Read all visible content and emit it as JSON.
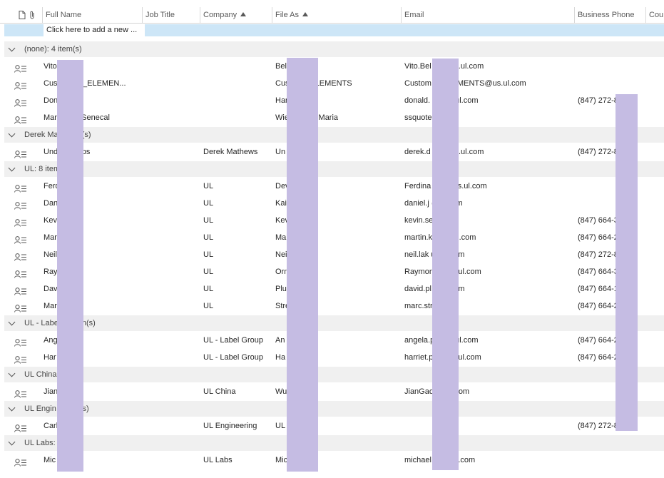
{
  "columns": {
    "full_name": "Full Name",
    "job_title": "Job Title",
    "company": "Company",
    "file_as": "File As",
    "email": "Email",
    "business_phone": "Business Phone",
    "country": "Cou"
  },
  "add_new": "Click here to add a new ...",
  "groups": [
    {
      "label": "(none): 4 item(s)",
      "rows": [
        {
          "name": "Vito  atuono",
          "job": "",
          "company": "",
          "file_as": "Bel  o, Vito.",
          "email": "Vito.Bel  no@us.ul.com",
          "phone": ""
        },
        {
          "name": "Cust  ervice_ELEMEN...",
          "job": "",
          "company": "",
          "file_as": "Cus  vice_ELEMENTS",
          "email": "Custom  e_ELEMENTS@us.ul.com",
          "phone": ""
        },
        {
          "name": "Don  on",
          "job": "",
          "company": "",
          "file_as": "Har  n",
          "email": "donald.  n@us.ul.com",
          "phone": "(847) 272-8  x..."
        },
        {
          "name": "Mar  maier-Senecal",
          "job": "",
          "company": "",
          "file_as": "Wie  enecal, Maria",
          "email": "ssquote  .com",
          "phone": ""
        }
      ]
    },
    {
      "label": "Derek Ma  1 item(s)",
      "rows": [
        {
          "name": "Und  ers Labs",
          "job": "",
          "company": "Derek Mathews",
          "file_as": "Un  rs Labs",
          "email": "derek.d  ws@us.ul.com",
          "phone": "(847) 272-8"
        }
      ]
    },
    {
      "label": "UL: 8 item",
      "rows": [
        {
          "name": "Ferd  s",
          "job": "",
          "company": "UL",
          "file_as": "Dev  d",
          "email": "Ferdina  oss@us.ul.com",
          "phone": ""
        },
        {
          "name": "Dan  er",
          "job": "",
          "company": "UL",
          "file_as": "Kai  el",
          "email": "daniel.j  @ul.com",
          "phone": ""
        },
        {
          "name": "Kevi",
          "job": "",
          "company": "UL",
          "file_as": "Kev",
          "email": "kevin.se  ul.com",
          "phone": "(847) 664-3"
        },
        {
          "name": "Mar  an",
          "job": "",
          "company": "UL",
          "file_as": "Ma  n",
          "email": "martin.k  @us.ul.com",
          "phone": "(847) 664-2"
        },
        {
          "name": "Neil  ak",
          "job": "",
          "company": "UL",
          "file_as": "Nei  ak",
          "email": "neil.lak  us.ul.com",
          "phone": "(847) 272-8"
        },
        {
          "name": "Ray  Ornias",
          "job": "",
          "company": "UL",
          "file_as": "Orn  mond",
          "email": "Raymon  nias@ul.com",
          "phone": "(847) 664-3"
        },
        {
          "name": "Dav  mer",
          "job": "",
          "company": "UL",
          "file_as": "Plu  avid",
          "email": "david.pl  @ul.com",
          "phone": "(847) 664-1"
        },
        {
          "name": "Mar  g",
          "job": "",
          "company": "UL",
          "file_as": "Stre  rc",
          "email": "marc.str  ul.com",
          "phone": "(847) 664-2"
        }
      ]
    },
    {
      "label": "UL - Labe  : 2 item(s)",
      "rows": [
        {
          "name": "Ang  ne",
          "job": "",
          "company": "UL - Label Group",
          "file_as": "An  ne",
          "email": "angela.p  @us.ul.com",
          "phone": "(847) 664-2  ..."
        },
        {
          "name": "Har  gen",
          "job": "",
          "company": "UL - Label Group",
          "file_as": "Ha  en",
          "email": "harriet.p  n@us.ul.com",
          "phone": "(847) 664-2  ..."
        }
      ]
    },
    {
      "label": "UL China  s)",
      "rows": [
        {
          "name": "Jian  u",
          "job": "",
          "company": "UL China",
          "file_as": "Wu  o",
          "email": "JianGao  cn.ul.com",
          "phone": ""
        }
      ]
    },
    {
      "label": "UL Engin  1 item(s)",
      "rows": [
        {
          "name": "Carl  emi",
          "job": "",
          "company": "UL Engineering",
          "file_as": "UL  ring",
          "email": "",
          "phone": "(847) 272-8  ..."
        }
      ]
    },
    {
      "label": "UL Labs:  )",
      "rows": [
        {
          "name": "Mic  tz",
          "job": "",
          "company": "UL Labs",
          "file_as": "Mic  z",
          "email": "michael  @us.ul.com",
          "phone": ""
        }
      ]
    }
  ],
  "icons": {
    "document": "document-icon",
    "attachment": "paperclip-icon",
    "contact": "contact-card-icon",
    "group_toggle": "chevron-down-icon",
    "sort": "sort-ascending-icon"
  },
  "colors": {
    "selected_row": "#cde6f7",
    "group_bg": "#f0f0f0",
    "redaction": "#c5bce3"
  }
}
